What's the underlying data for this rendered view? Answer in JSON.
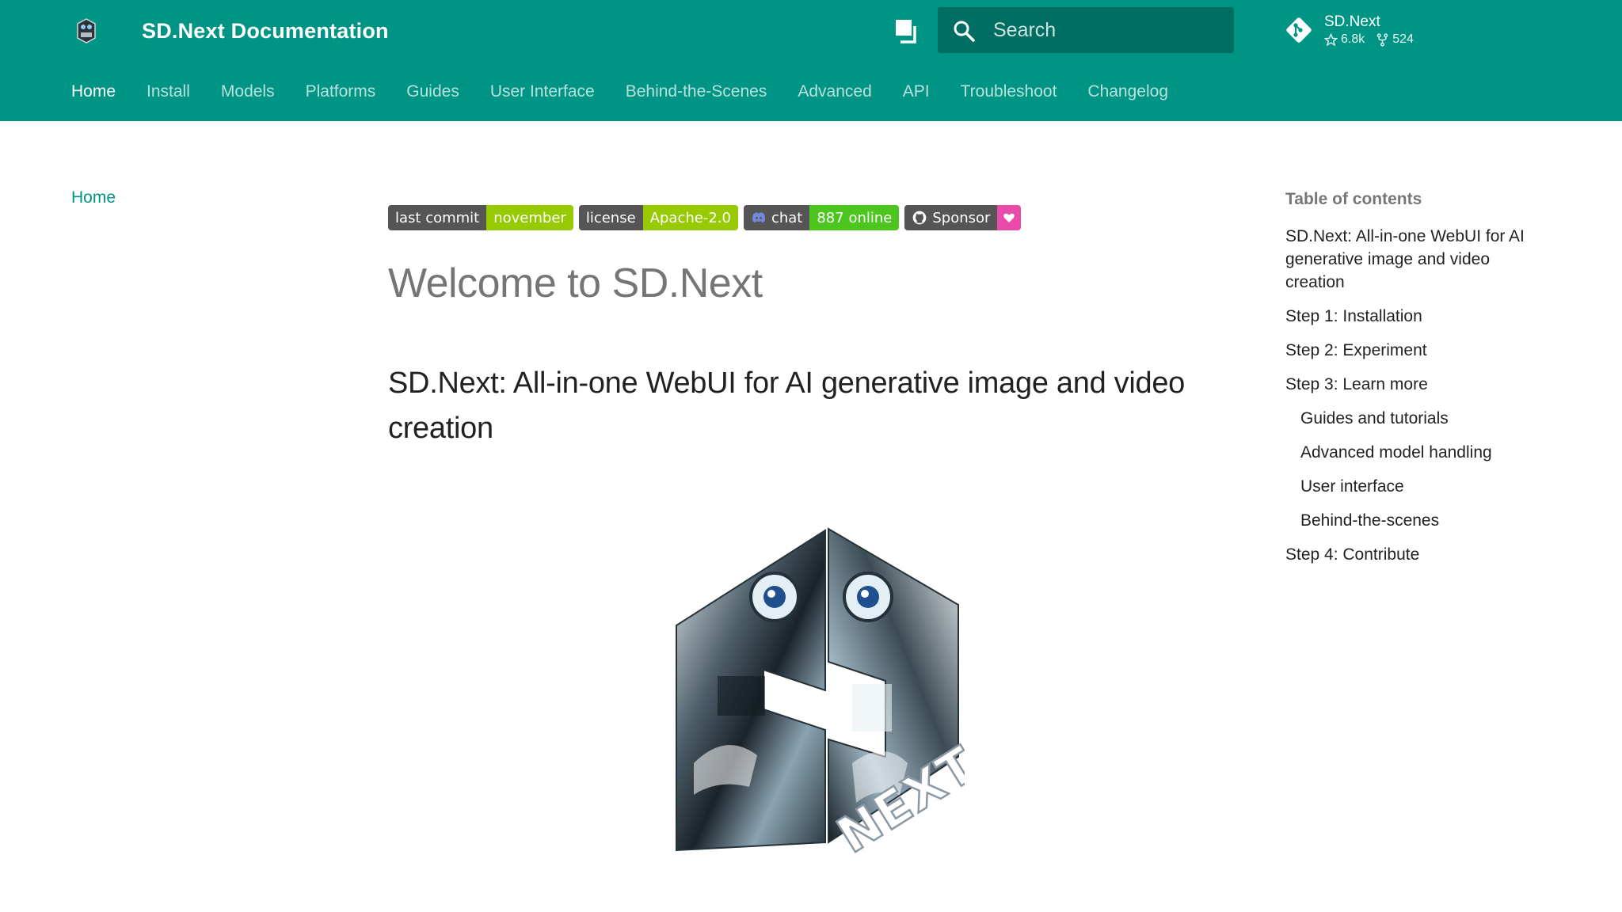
{
  "header": {
    "title": "SD.Next Documentation",
    "logo_icon": "sdnext-logo-icon",
    "palette_icon": "color-palette-icon",
    "search": {
      "placeholder": "Search",
      "icon": "search-icon"
    },
    "repo": {
      "name": "SD.Next",
      "stars": "6.8k",
      "forks": "524",
      "icon": "git-icon"
    },
    "colors": {
      "primary": "#009485",
      "white": "#ffffff"
    }
  },
  "tabs": [
    {
      "label": "Home",
      "active": true
    },
    {
      "label": "Install"
    },
    {
      "label": "Models"
    },
    {
      "label": "Platforms"
    },
    {
      "label": "Guides"
    },
    {
      "label": "User Interface"
    },
    {
      "label": "Behind-the-Scenes"
    },
    {
      "label": "Advanced"
    },
    {
      "label": "API"
    },
    {
      "label": "Troubleshoot"
    },
    {
      "label": "Changelog"
    }
  ],
  "left_nav": {
    "home": "Home"
  },
  "badges": [
    {
      "left": "last commit",
      "right": "november",
      "right_color": "#97ca00"
    },
    {
      "left": "license",
      "right": "Apache-2.0",
      "right_color": "#97ca00"
    },
    {
      "left": "chat",
      "right": "887 online",
      "right_color": "#4cc61e",
      "icon": "discord-icon"
    },
    {
      "left": "Sponsor",
      "right": "",
      "right_color": "#ea4aaa",
      "icon": "github-icon",
      "right_icon": "heart-icon"
    }
  ],
  "content": {
    "title": "Welcome to SD.Next",
    "heading": "SD.Next: All-in-one WebUI for AI generative image and video creation",
    "hero_image": "sdnext-hero-logo",
    "hero_text": "NEXT"
  },
  "toc": {
    "title": "Table of contents",
    "items": [
      {
        "label": "SD.Next: All-in-one WebUI for AI generative image and video creation",
        "level": 1
      },
      {
        "label": "Step 1: Installation",
        "level": 1
      },
      {
        "label": "Step 2: Experiment",
        "level": 1
      },
      {
        "label": "Step 3: Learn more",
        "level": 1
      },
      {
        "label": "Guides and tutorials",
        "level": 2
      },
      {
        "label": "Advanced model handling",
        "level": 2
      },
      {
        "label": "User interface",
        "level": 2
      },
      {
        "label": "Behind-the-scenes",
        "level": 2
      },
      {
        "label": "Step 4: Contribute",
        "level": 1
      }
    ]
  }
}
